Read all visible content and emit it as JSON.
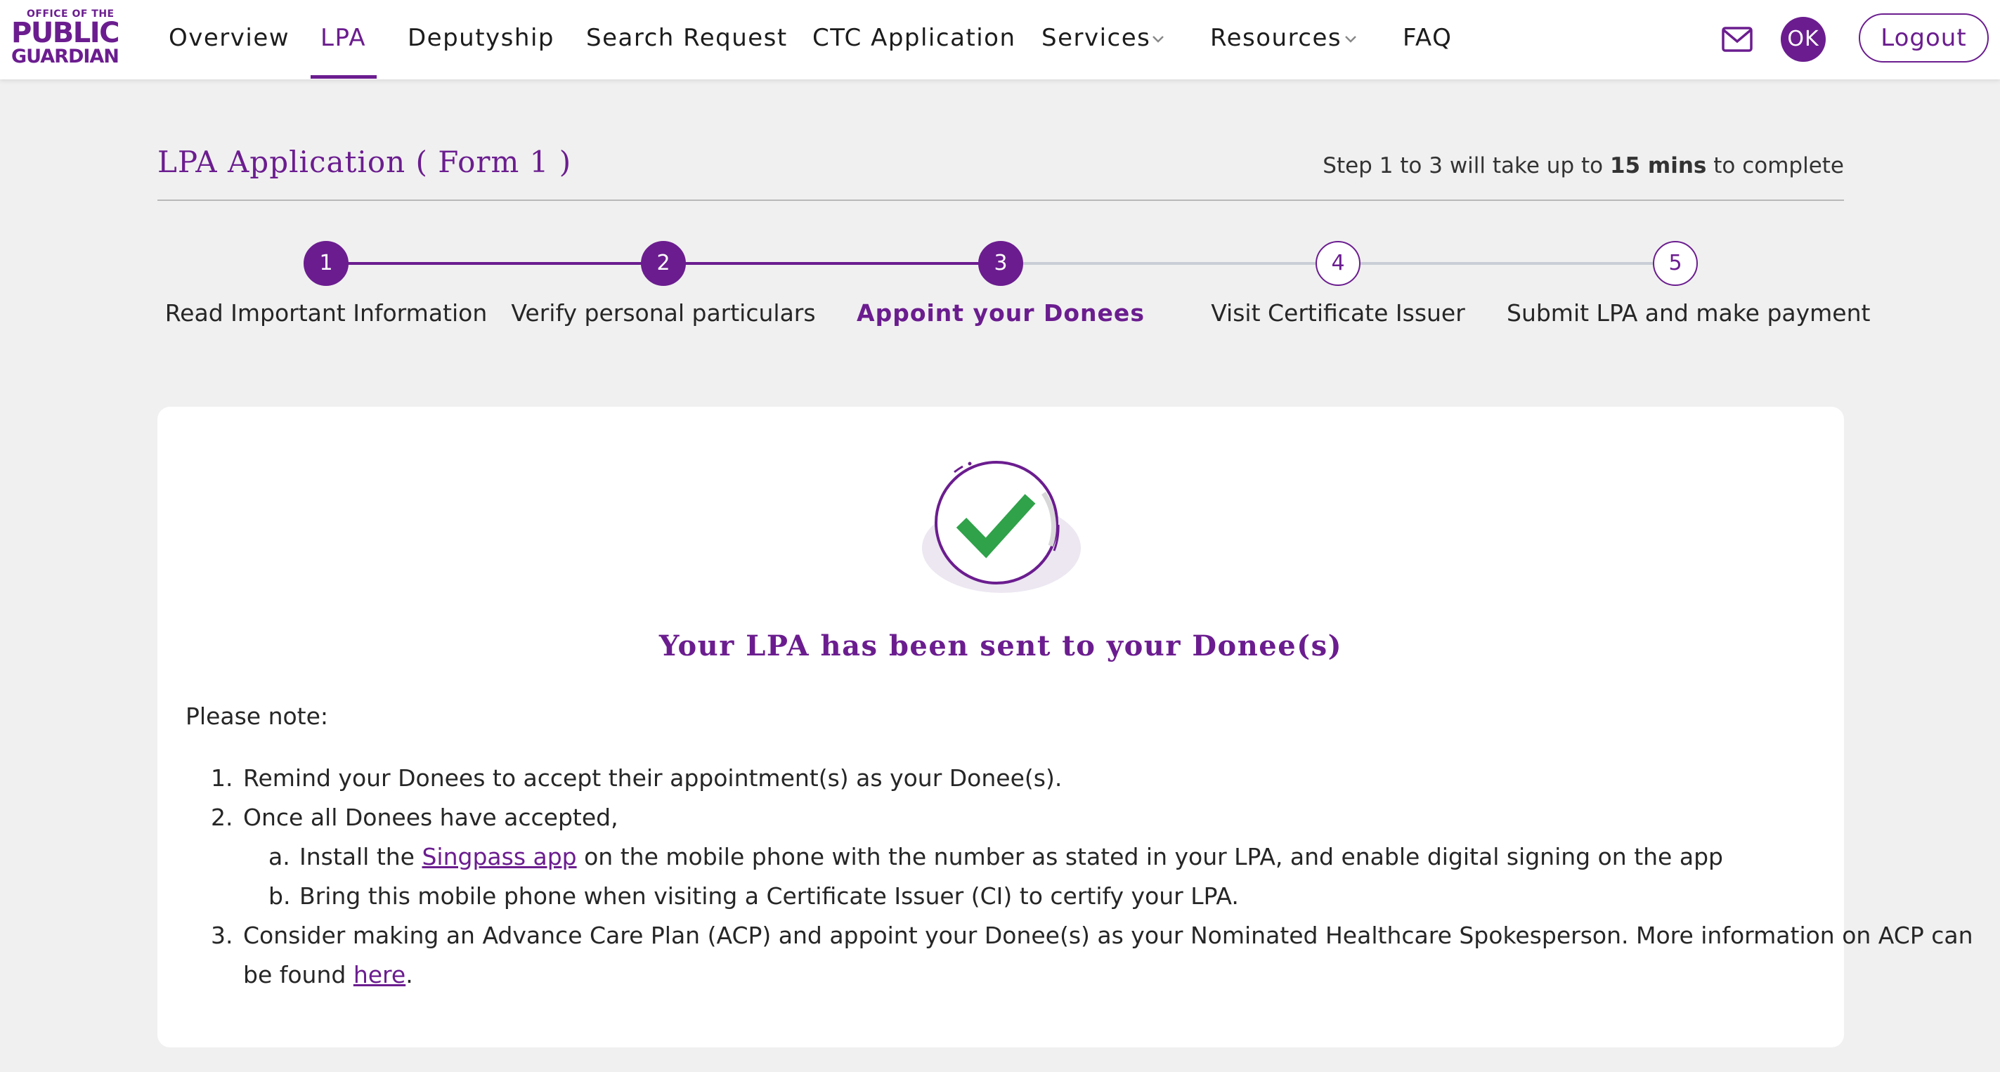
{
  "brand": {
    "logo_line1": "OFFICE OF THE",
    "logo_line2": "PUBLIC",
    "logo_line3": "GUARDIAN",
    "accent_color": "#6b1d8f"
  },
  "nav": {
    "items": [
      {
        "label": "Overview"
      },
      {
        "label": "LPA",
        "active": true
      },
      {
        "label": "Deputyship"
      },
      {
        "label": "Search Request"
      },
      {
        "label": "CTC Application"
      },
      {
        "label": "Services",
        "has_dropdown": true
      },
      {
        "label": "Resources",
        "has_dropdown": true
      },
      {
        "label": "FAQ"
      }
    ],
    "mail_icon": "mail-icon",
    "avatar_initials": "OK",
    "logout_label": "Logout"
  },
  "application": {
    "title": "LPA Application ( Form 1 )",
    "time_prefix": "Step 1 to 3 will take up to",
    "time_bold": "15 mins",
    "time_suffix": "to complete"
  },
  "stepper": {
    "current_step": 3,
    "steps": [
      {
        "number": "1",
        "label": "Read Important Information",
        "status": "done"
      },
      {
        "number": "2",
        "label": "Verify personal particulars",
        "status": "done"
      },
      {
        "number": "3",
        "label": "Appoint your Donees",
        "status": "current"
      },
      {
        "number": "4",
        "label": "Visit Certificate Issuer",
        "status": "todo"
      },
      {
        "number": "5",
        "label": "Submit LPA and make payment",
        "status": "todo"
      }
    ]
  },
  "result": {
    "icon": "success-check-icon",
    "heading": "Your LPA has been sent to your Donee(s)",
    "note_intro": "Please note:",
    "item1_num": "1.",
    "item1": "Remind your Donees to accept their appointment(s) as your Donee(s).",
    "item2_num": "2.",
    "item2": "Once all Donees have accepted,",
    "item2a_letter": "a.",
    "item2a_prefix": "Install the ",
    "item2a_link": "Singpass app",
    "item2a_suffix": " on the mobile phone with the number as stated in your LPA, and enable digital signing on the app",
    "item2b_letter": "b.",
    "item2b": "Bring this mobile phone when visiting a Certificate Issuer (CI) to certify your LPA.",
    "item3_num": "3.",
    "item3_line1": "Consider making an Advance Care Plan (ACP) and appoint your Donee(s) as your Nominated Healthcare Spokesperson. More information on ACP can",
    "item3_line2_prefix": "be found ",
    "item3_link": "here",
    "item3_line2_suffix": "."
  }
}
